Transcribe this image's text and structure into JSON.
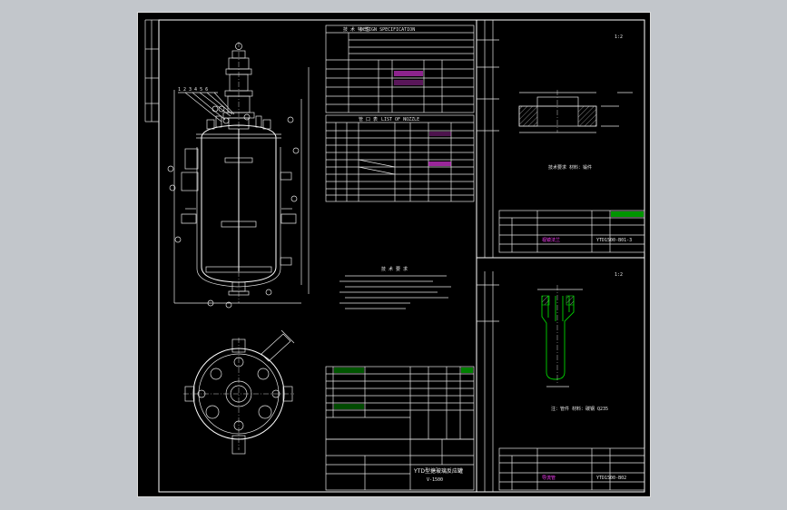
{
  "drawing": {
    "tech_spec_header": "技  术  特  性",
    "tech_spec_heading_en": "DESIGN SPECIFICATION",
    "nozzle_table_header": "管    口    表",
    "nozzle_table_heading_en": "LIST OF NOZZLE",
    "tech_requirements_title": "技  术  要  求",
    "title_block_name": "YTD型搪玻璃反应罐",
    "title_block_code": "V-1500",
    "detail_scale_1": "1:2",
    "detail_scale_2": "1:2",
    "detail_upper_note": "技术要求  材料：锻件",
    "detail_lower_note": "注：管件 材料：碳钢  Q235",
    "detail_upper_part_name": "视镜法兰",
    "detail_lower_part_name": "导流管",
    "detail_upper_code": "YTD1500-B01-3",
    "detail_lower_code": "YTD1500-B02"
  },
  "colors": {
    "background": "#c2c6cb",
    "sheet": "#000000",
    "line": "#e6e6e6",
    "highlight_green": "#00d400",
    "highlight_magenta": "#ff40ff"
  }
}
